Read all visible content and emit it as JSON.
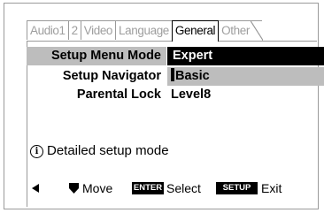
{
  "tabs": [
    {
      "label": "Audio1",
      "active": false
    },
    {
      "label": "2",
      "active": false
    },
    {
      "label": "Video",
      "active": false
    },
    {
      "label": "Language",
      "active": false
    },
    {
      "label": "General",
      "active": true
    },
    {
      "label": "Other",
      "active": false
    }
  ],
  "settings": [
    {
      "label": "Setup Menu Mode",
      "value": "Expert"
    },
    {
      "label": "Setup Navigator",
      "value": "Basic"
    },
    {
      "label": "Parental Lock",
      "value": "Level8"
    }
  ],
  "info": {
    "icon": "info-icon",
    "text": "Detailed setup mode"
  },
  "footer": {
    "move_label": "Move",
    "enter_key": "ENTER",
    "select_label": "Select",
    "setup_key": "SETUP",
    "exit_label": "Exit"
  },
  "colors": {
    "highlight": "#bdbdbd",
    "selected_bg": "#000000",
    "border": "#9a9a9a"
  }
}
